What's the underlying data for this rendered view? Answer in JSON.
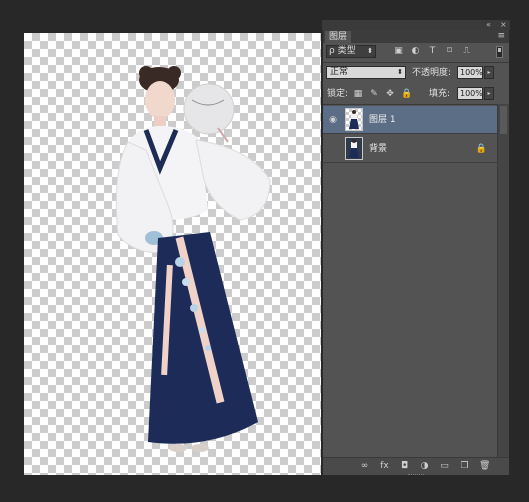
{
  "panel": {
    "collapse_glyph": "«",
    "close_glyph": "×",
    "tab_label": "图层",
    "menu_glyph": "≡",
    "filter": {
      "label": "ρ 类型",
      "arrow": "⬍"
    },
    "filter_icons": [
      "image-filter-icon",
      "adjustment-filter-icon",
      "type-filter-icon",
      "shape-filter-icon",
      "smart-object-filter-icon"
    ],
    "filter_glyphs": [
      "▣",
      "◐",
      "T",
      "⌑",
      "⎍"
    ],
    "blend_mode": {
      "value": "正常",
      "arrow": "⬍"
    },
    "opacity": {
      "label": "不透明度:",
      "value": "100%",
      "arrow": "▸"
    },
    "lock": {
      "label": "锁定:",
      "glyphs": [
        "▦",
        "✎",
        "✥",
        "🔒"
      ]
    },
    "fill": {
      "label": "填充:",
      "value": "100%",
      "arrow": "▸"
    },
    "layers": [
      {
        "name": "图层 1",
        "visible": true,
        "selected": true,
        "eye": "◉",
        "locked": false,
        "lock_glyph": ""
      },
      {
        "name": "背景",
        "visible": false,
        "selected": false,
        "eye": "",
        "locked": true,
        "lock_glyph": "🔒"
      }
    ],
    "bottom_glyphs": [
      "∞",
      "fx",
      "◘",
      "◑",
      "▭",
      "❐",
      "🗑"
    ]
  },
  "colors": {
    "panel_bg": "#535353",
    "selected_layer": "#5c6e86",
    "workspace": "#282828"
  }
}
